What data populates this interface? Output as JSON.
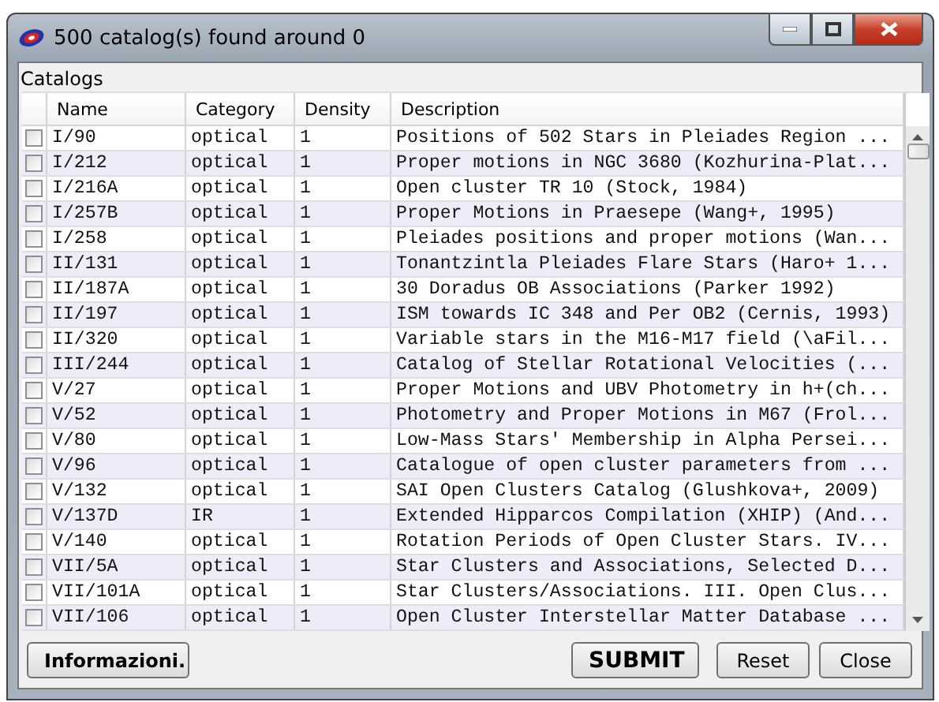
{
  "window": {
    "title": "500 catalog(s) found around 0"
  },
  "panel": {
    "title": "Catalogs"
  },
  "table": {
    "columns": [
      "Name",
      "Category",
      "Density",
      "Description"
    ],
    "rows": [
      {
        "checked": false,
        "cells": [
          "I/90",
          "optical",
          "1",
          "Positions of 502 Stars in Pleiades Region ..."
        ]
      },
      {
        "checked": false,
        "cells": [
          "I/212",
          "optical",
          "1",
          "Proper motions in NGC 3680 (Kozhurina-Plat..."
        ]
      },
      {
        "checked": false,
        "cells": [
          "I/216A",
          "optical",
          "1",
          "Open cluster TR 10 (Stock, 1984)"
        ]
      },
      {
        "checked": false,
        "cells": [
          "I/257B",
          "optical",
          "1",
          "Proper Motions in Praesepe (Wang+, 1995)"
        ]
      },
      {
        "checked": false,
        "cells": [
          "I/258",
          "optical",
          "1",
          "Pleiades positions and proper motions (Wan..."
        ]
      },
      {
        "checked": false,
        "cells": [
          "II/131",
          "optical",
          "1",
          "Tonantzintla Pleiades Flare Stars (Haro+ 1..."
        ]
      },
      {
        "checked": false,
        "cells": [
          "II/187A",
          "optical",
          "1",
          "30 Doradus OB Associations (Parker 1992)"
        ]
      },
      {
        "checked": false,
        "cells": [
          "II/197",
          "optical",
          "1",
          "ISM towards IC 348 and Per OB2 (Cernis, 1993)"
        ]
      },
      {
        "checked": false,
        "cells": [
          "II/320",
          "optical",
          "1",
          "Variable stars in the M16-M17 field (\\aFil..."
        ]
      },
      {
        "checked": false,
        "cells": [
          "III/244",
          "optical",
          "1",
          "Catalog of Stellar Rotational Velocities (..."
        ]
      },
      {
        "checked": false,
        "cells": [
          "V/27",
          "optical",
          "1",
          "Proper Motions and UBV Photometry in h+(ch..."
        ]
      },
      {
        "checked": false,
        "cells": [
          "V/52",
          "optical",
          "1",
          "Photometry and Proper Motions in M67 (Frol..."
        ]
      },
      {
        "checked": false,
        "cells": [
          "V/80",
          "optical",
          "1",
          "Low-Mass Stars' Membership in Alpha Persei..."
        ]
      },
      {
        "checked": false,
        "cells": [
          "V/96",
          "optical",
          "1",
          "Catalogue of open cluster parameters from ..."
        ]
      },
      {
        "checked": false,
        "cells": [
          "V/132",
          "optical",
          "1",
          "SAI Open Clusters Catalog (Glushkova+, 2009)"
        ]
      },
      {
        "checked": false,
        "cells": [
          "V/137D",
          "IR",
          "1",
          "Extended Hipparcos Compilation (XHIP) (And..."
        ]
      },
      {
        "checked": false,
        "cells": [
          "V/140",
          "optical",
          "1",
          "Rotation Periods of Open Cluster Stars. IV..."
        ]
      },
      {
        "checked": false,
        "cells": [
          "VII/5A",
          "optical",
          "1",
          "Star Clusters and Associations, Selected D..."
        ]
      },
      {
        "checked": false,
        "cells": [
          "VII/101A",
          "optical",
          "1",
          "Star Clusters/Associations. III. Open Clus..."
        ]
      },
      {
        "checked": false,
        "cells": [
          "VII/106",
          "optical",
          "1",
          "Open Cluster Interstellar Matter Database ..."
        ]
      }
    ]
  },
  "buttons": [
    {
      "label": "Informazioni.",
      "kind": "info"
    },
    {
      "label": "SUBMIT",
      "kind": "primary"
    },
    {
      "label": "Reset",
      "kind": "plain"
    },
    {
      "label": "Close",
      "kind": "plain"
    }
  ]
}
